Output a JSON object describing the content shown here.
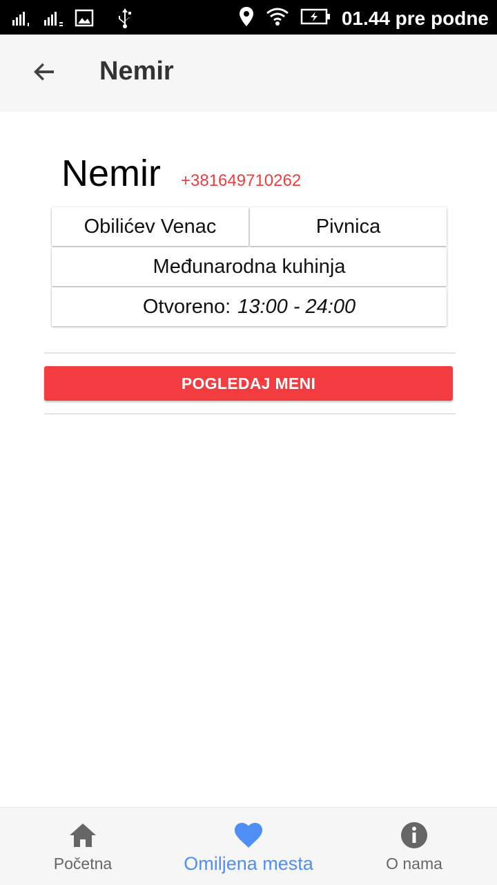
{
  "status_bar": {
    "time": "01.44 pre podne",
    "icons": [
      "signal-sim1-icon",
      "signal-sim2-icon",
      "image-icon",
      "usb-icon",
      "location-icon",
      "wifi-icon",
      "battery-charging-icon"
    ]
  },
  "app_bar": {
    "back_icon": "arrow-back-icon",
    "title": "Nemir"
  },
  "place": {
    "name": "Nemir",
    "phone": "+381649710262",
    "location": "Obilićev Venac",
    "type": "Pivnica",
    "cuisine": "Međunarodna kuhinja",
    "hours_label": "Otvoreno:",
    "hours": "13:00 - 24:00"
  },
  "menu_button": {
    "label": "POGLEDAJ MENI",
    "color": "#f23c3f"
  },
  "bottom_nav": {
    "items": [
      {
        "label": "Početna",
        "icon": "home-icon",
        "active": false
      },
      {
        "label": "Omiljena mesta",
        "icon": "heart-icon",
        "active": true
      },
      {
        "label": "O nama",
        "icon": "info-icon",
        "active": false
      }
    ],
    "active_color": "#4f8ff5",
    "inactive_color": "#666666"
  }
}
